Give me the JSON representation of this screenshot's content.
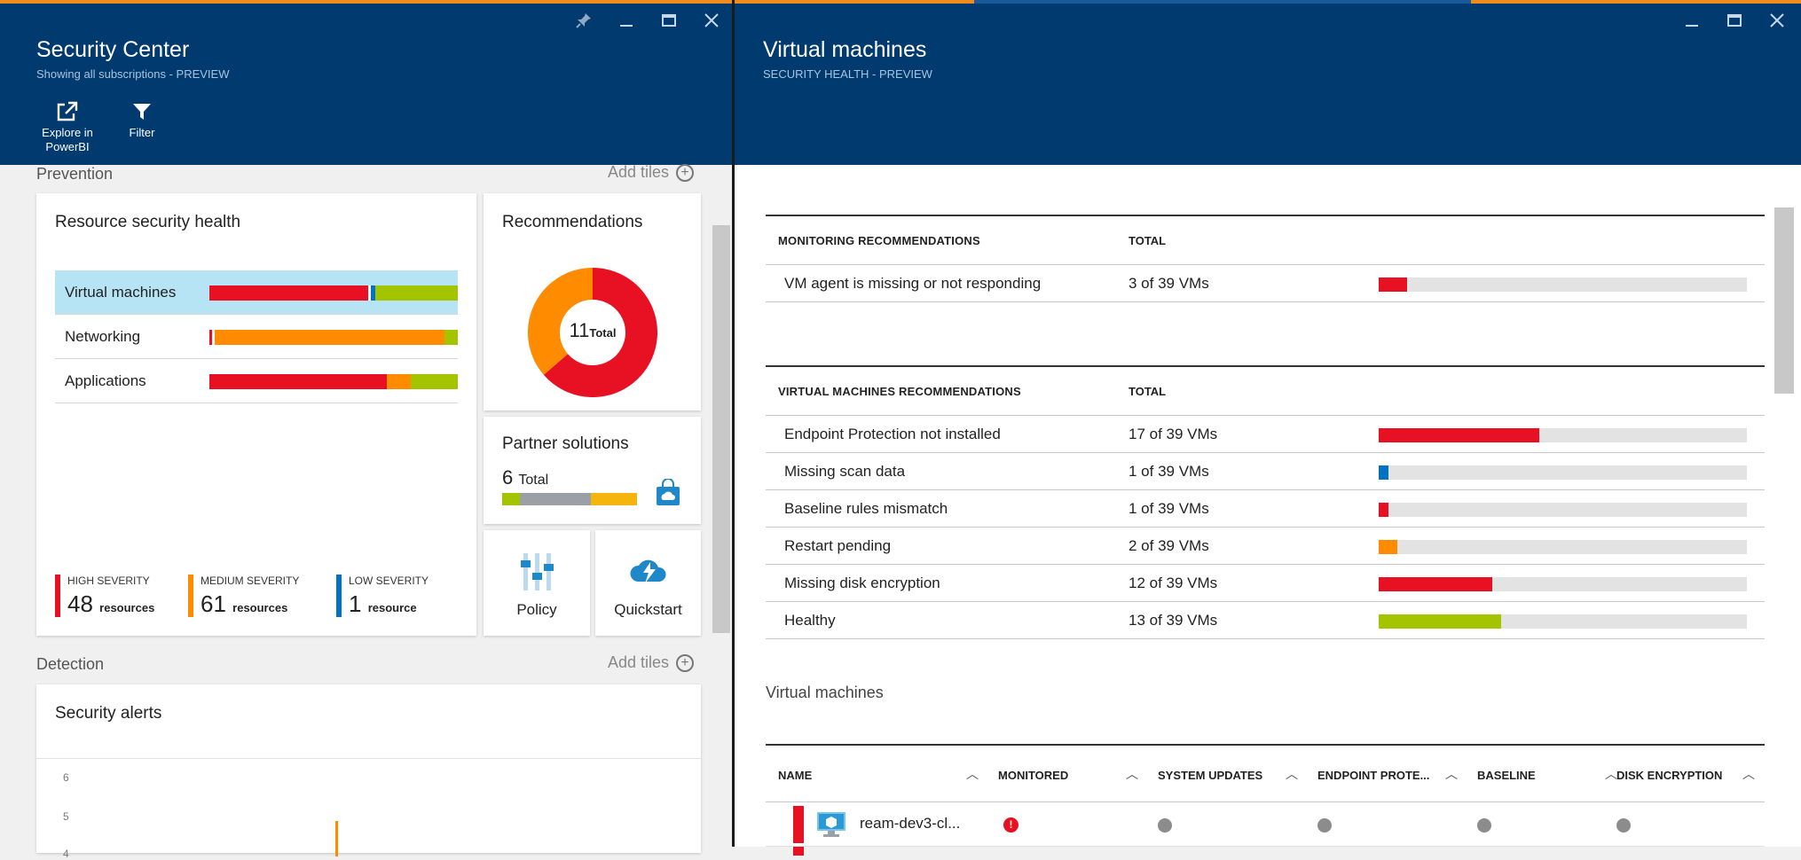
{
  "colors": {
    "high": "#e81123",
    "medium": "#ff8c00",
    "low": "#0072c6",
    "healthy": "#a4c400",
    "grey": "#9aa0a6",
    "yellow": "#f6b40e",
    "header": "#003a6e"
  },
  "left_blade": {
    "title": "Security Center",
    "subtitle": "Showing all subscriptions - PREVIEW",
    "commands": [
      {
        "label": "Explore in PowerBI",
        "icon": "external-link-icon"
      },
      {
        "label": "Filter",
        "icon": "filter-icon"
      }
    ],
    "prevention": {
      "label": "Prevention",
      "add_tiles": "Add tiles",
      "resource_health": {
        "title": "Resource security health",
        "rows": [
          {
            "label": "Virtual machines",
            "segments": [
              {
                "color": "#e81123",
                "pct": 64
              },
              {
                "color": "#ffffff",
                "pct": 1
              },
              {
                "color": "#0072c6",
                "pct": 1.8
              },
              {
                "color": "#a4c400",
                "pct": 33.2
              }
            ]
          },
          {
            "label": "Networking",
            "segments": [
              {
                "color": "#e81123",
                "pct": 1
              },
              {
                "color": "#ffffff",
                "pct": 1
              },
              {
                "color": "#ff8c00",
                "pct": 92.5
              },
              {
                "color": "#a4c400",
                "pct": 5.5
              }
            ]
          },
          {
            "label": "Applications",
            "segments": [
              {
                "color": "#e81123",
                "pct": 71.5
              },
              {
                "color": "#ff8c00",
                "pct": 9.5
              },
              {
                "color": "#a4c400",
                "pct": 19
              }
            ]
          }
        ],
        "severities": [
          {
            "caption": "HIGH SEVERITY",
            "count": "48",
            "unit": "resources",
            "color": "#e81123"
          },
          {
            "caption": "MEDIUM SEVERITY",
            "count": "61",
            "unit": "resources",
            "color": "#ff8c00"
          },
          {
            "caption": "LOW SEVERITY",
            "count": "1",
            "unit": "resource",
            "color": "#0072c6"
          }
        ]
      },
      "recommendations": {
        "title": "Recommendations",
        "total": "11",
        "total_label": "Total",
        "donut": [
          {
            "color": "#e81123",
            "value": 7
          },
          {
            "color": "#ff8c00",
            "value": 4
          }
        ]
      },
      "partner": {
        "title": "Partner solutions",
        "count": "6",
        "count_label": "Total",
        "segments": [
          {
            "color": "#a4c400",
            "pct": 13
          },
          {
            "color": "#9aa0a6",
            "pct": 53
          },
          {
            "color": "#f6b40e",
            "pct": 34
          }
        ]
      },
      "policy": {
        "label": "Policy"
      },
      "quickstart": {
        "label": "Quickstart"
      }
    },
    "detection": {
      "label": "Detection",
      "add_tiles": "Add tiles",
      "alerts": {
        "title": "Security alerts",
        "yticks": [
          "6",
          "5",
          "4"
        ]
      }
    }
  },
  "right_blade": {
    "title": "Virtual machines",
    "subtitle": "SECURITY HEALTH - PREVIEW",
    "monitoring": {
      "header": "MONITORING RECOMMENDATIONS",
      "total_header": "TOTAL",
      "rows": [
        {
          "name": "VM agent is missing or not responding",
          "total": "3 of 39 VMs",
          "fraction": 0.077,
          "color": "#e81123"
        }
      ]
    },
    "vm_recommendations": {
      "header": "VIRTUAL MACHINES RECOMMENDATIONS",
      "total_header": "TOTAL",
      "rows": [
        {
          "name": "Endpoint Protection not installed",
          "total": "17 of 39 VMs",
          "fraction": 0.436,
          "color": "#e81123"
        },
        {
          "name": "Missing scan data",
          "total": "1 of 39 VMs",
          "fraction": 0.026,
          "color": "#0072c6"
        },
        {
          "name": "Baseline rules mismatch",
          "total": "1 of 39 VMs",
          "fraction": 0.026,
          "color": "#e81123"
        },
        {
          "name": "Restart pending",
          "total": "2 of 39 VMs",
          "fraction": 0.051,
          "color": "#ff8c00"
        },
        {
          "name": "Missing disk encryption",
          "total": "12 of 39 VMs",
          "fraction": 0.308,
          "color": "#e81123"
        },
        {
          "name": "Healthy",
          "total": "13 of 39 VMs",
          "fraction": 0.333,
          "color": "#a4c400"
        }
      ]
    },
    "vm_list": {
      "label": "Virtual machines",
      "columns": [
        "NAME",
        "MONITORED",
        "SYSTEM UPDATES",
        "ENDPOINT PROTE...",
        "BASELINE",
        "DISK ENCRYPTION"
      ],
      "rows": [
        {
          "name": "ream-dev3-cl..."
        }
      ]
    }
  }
}
